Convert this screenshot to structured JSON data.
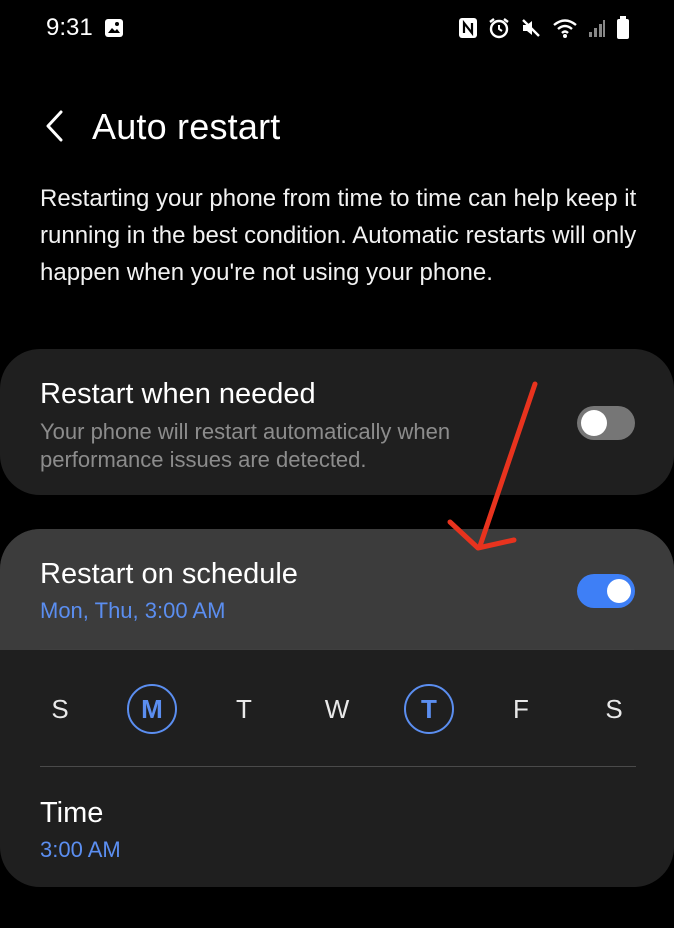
{
  "status_bar": {
    "time": "9:31",
    "left_icons": [
      "gallery-icon"
    ],
    "right_icons": [
      "nfc-icon",
      "alarm-icon",
      "mute-icon",
      "wifi-icon",
      "signal-icon",
      "battery-icon"
    ]
  },
  "header": {
    "back_icon": "chevron-left-icon",
    "title": "Auto restart"
  },
  "description": "Restarting your phone from time to time can help keep it running in the best condition. Automatic restarts will only happen when you're not using your phone.",
  "restart_when_needed": {
    "title": "Restart when needed",
    "subtitle": "Your phone will restart automatically when performance issues are detected.",
    "enabled": false
  },
  "restart_on_schedule": {
    "title": "Restart on schedule",
    "summary": "Mon, Thu, 3:00 AM",
    "enabled": true,
    "days": [
      {
        "label": "S",
        "selected": false
      },
      {
        "label": "M",
        "selected": true
      },
      {
        "label": "T",
        "selected": false
      },
      {
        "label": "W",
        "selected": false
      },
      {
        "label": "T",
        "selected": true
      },
      {
        "label": "F",
        "selected": false
      },
      {
        "label": "S",
        "selected": false
      }
    ],
    "time_label": "Time",
    "time_value": "3:00 AM"
  },
  "colors": {
    "accent": "#5b8ef0",
    "toggle_on": "#3e7ff6",
    "annotation_arrow": "#e8331e"
  }
}
